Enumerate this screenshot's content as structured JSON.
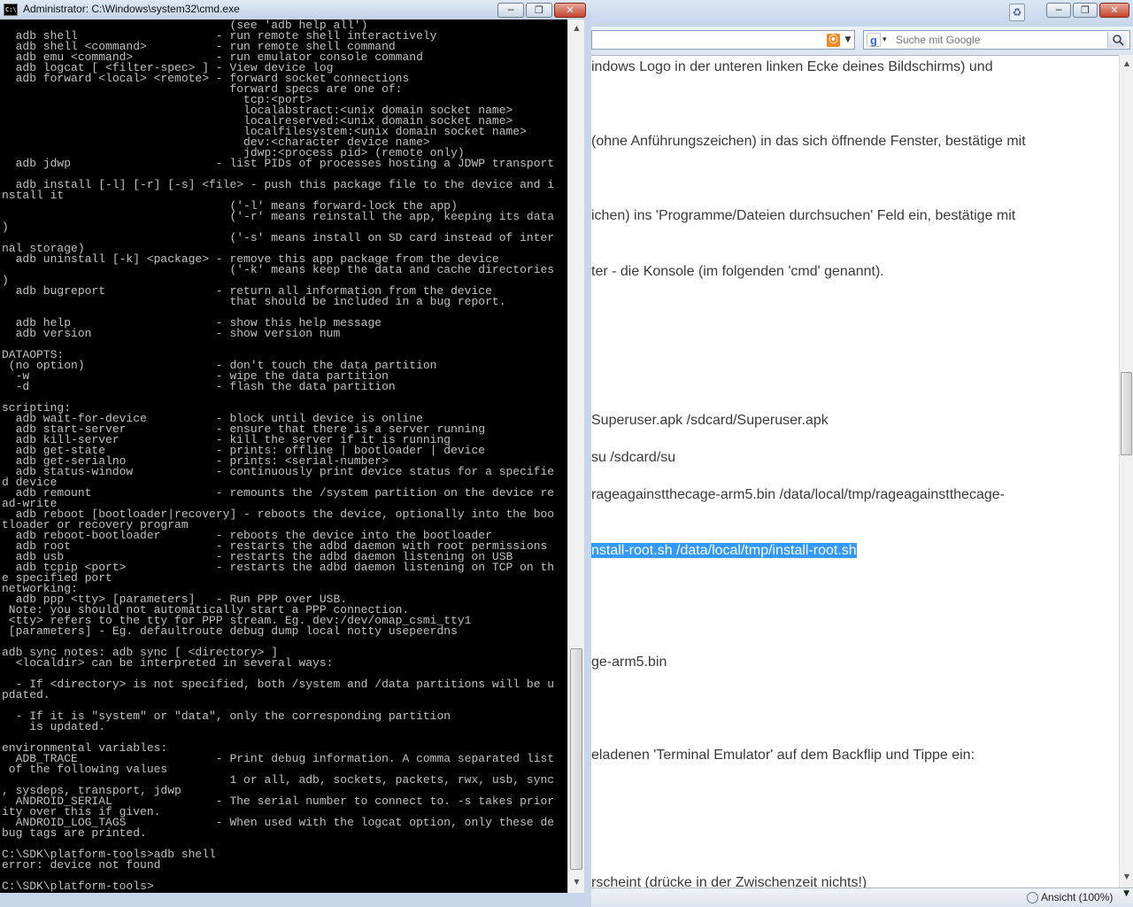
{
  "browser": {
    "search_placeholder": "Suche mit Google",
    "google_icon_char": "g",
    "rss_icon_char": "⦿",
    "lines": [
      "indows Logo in der unteren linken Ecke deines Bildschirms) und",
      "(ohne Anführungszeichen) in das sich öffnende Fenster, bestätige mit",
      "ichen) ins 'Programme/Dateien durchsuchen' Feld ein, bestätige mit",
      "ter - die Konsole (im folgenden 'cmd' genannt).",
      "Superuser.apk /sdcard/Superuser.apk",
      "su /sdcard/su",
      "rageagainstthecage-arm5.bin /data/local/tmp/rageagainstthecage-",
      "nstall-root.sh /data/local/tmp/install-root.sh",
      "ge-arm5.bin",
      "eladenen 'Terminal Emulator' auf dem Backflip und Tippe ein:",
      "rscheint (drücke in der Zwischenzeit nichts!)"
    ],
    "zoom": "Ansicht (100%)",
    "icons": [
      "recycle-icon",
      "rss-icon",
      "google-icon",
      "search-icon",
      "zoom-icon"
    ]
  },
  "cmd": {
    "title": "Administrator: C:\\Windows\\system32\\cmd.exe",
    "icon_text": "C:\\",
    "console": "                                 (see 'adb help all')\n  adb shell                    - run remote shell interactively\n  adb shell <command>          - run remote shell command\n  adb emu <command>            - run emulator console command\n  adb logcat [ <filter-spec> ] - View device log\n  adb forward <local> <remote> - forward socket connections\n                                 forward specs are one of:\n                                   tcp:<port>\n                                   localabstract:<unix domain socket name>\n                                   localreserved:<unix domain socket name>\n                                   localfilesystem:<unix domain socket name>\n                                   dev:<character device name>\n                                   jdwp:<process pid> (remote only)\n  adb jdwp                     - list PIDs of processes hosting a JDWP transport\n\n  adb install [-l] [-r] [-s] <file> - push this package file to the device and i\nnstall it\n                                 ('-l' means forward-lock the app)\n                                 ('-r' means reinstall the app, keeping its data\n)\n                                 ('-s' means install on SD card instead of inter\nnal storage)\n  adb uninstall [-k] <package> - remove this app package from the device\n                                 ('-k' means keep the data and cache directories\n)\n  adb bugreport                - return all information from the device\n                                 that should be included in a bug report.\n\n  adb help                     - show this help message\n  adb version                  - show version num\n\nDATAOPTS:\n (no option)                   - don't touch the data partition\n  -w                           - wipe the data partition\n  -d                           - flash the data partition\n\nscripting:\n  adb wait-for-device          - block until device is online\n  adb start-server             - ensure that there is a server running\n  adb kill-server              - kill the server if it is running\n  adb get-state                - prints: offline | bootloader | device\n  adb get-serialno             - prints: <serial-number>\n  adb status-window            - continuously print device status for a specifie\nd device\n  adb remount                  - remounts the /system partition on the device re\nad-write\n  adb reboot [bootloader|recovery] - reboots the device, optionally into the boo\ntloader or recovery program\n  adb reboot-bootloader        - reboots the device into the bootloader\n  adb root                     - restarts the adbd daemon with root permissions\n  adb usb                      - restarts the adbd daemon listening on USB\n  adb tcpip <port>             - restarts the adbd daemon listening on TCP on th\ne specified port\nnetworking:\n  adb ppp <tty> [parameters]   - Run PPP over USB.\n Note: you should not automatically start a PPP connection.\n <tty> refers to the tty for PPP stream. Eg. dev:/dev/omap_csmi_tty1\n [parameters] - Eg. defaultroute debug dump local notty usepeerdns\n\nadb sync notes: adb sync [ <directory> ]\n  <localdir> can be interpreted in several ways:\n\n  - If <directory> is not specified, both /system and /data partitions will be u\npdated.\n\n  - If it is \"system\" or \"data\", only the corresponding partition\n    is updated.\n\nenvironmental variables:\n  ADB_TRACE                    - Print debug information. A comma separated list\n of the following values\n                                 1 or all, adb, sockets, packets, rwx, usb, sync\n, sysdeps, transport, jdwp\n  ANDROID_SERIAL               - The serial number to connect to. -s takes prior\nity over this if given.\n  ANDROID_LOG_TAGS             - When used with the logcat option, only these de\nbug tags are printed.\n\nC:\\SDK\\platform-tools>adb shell\nerror: device not found\n\nC:\\SDK\\platform-tools>"
  }
}
